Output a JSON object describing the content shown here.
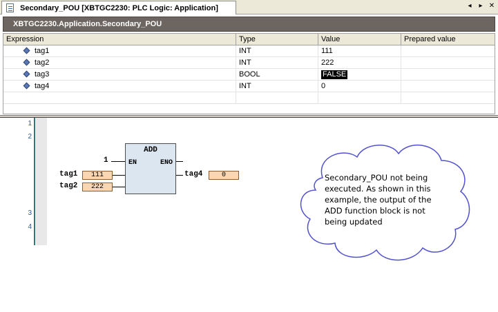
{
  "tab": {
    "title": "Secondary_POU [XBTGC2230: PLC Logic: Application]",
    "controls": [
      "◂",
      "▸",
      "✕"
    ]
  },
  "path": "XBTGC2230.Application.Secondary_POU",
  "watch": {
    "columns": [
      "Expression",
      "Type",
      "Value",
      "Prepared value"
    ],
    "rows": [
      {
        "expression": "tag1",
        "type": "INT",
        "value": "111",
        "prepared": ""
      },
      {
        "expression": "tag2",
        "type": "INT",
        "value": "222",
        "prepared": ""
      },
      {
        "expression": "tag3",
        "type": "BOOL",
        "value": "FALSE",
        "prepared": ""
      },
      {
        "expression": "tag4",
        "type": "INT",
        "value": "0",
        "prepared": ""
      }
    ]
  },
  "editor": {
    "line_numbers": [
      "1",
      "2",
      "3",
      "4"
    ],
    "block": {
      "name": "ADD",
      "in_en": "EN",
      "out_eno": "ENO",
      "en_constant": "1",
      "inputs": [
        {
          "var": "tag1",
          "value": "111"
        },
        {
          "var": "tag2",
          "value": "222"
        }
      ],
      "output": {
        "var": "tag4",
        "value": "0"
      }
    },
    "note": "Secondary_POU not being executed.  As shown in this example, the output of the ADD function block is not being updated"
  },
  "colors": {
    "path_bar": "#6d6560",
    "block_fill": "#dce6f0",
    "value_box": "#fad7b4",
    "cloud_border": "#5050d0",
    "gutter_line": "#2a7a7a"
  }
}
